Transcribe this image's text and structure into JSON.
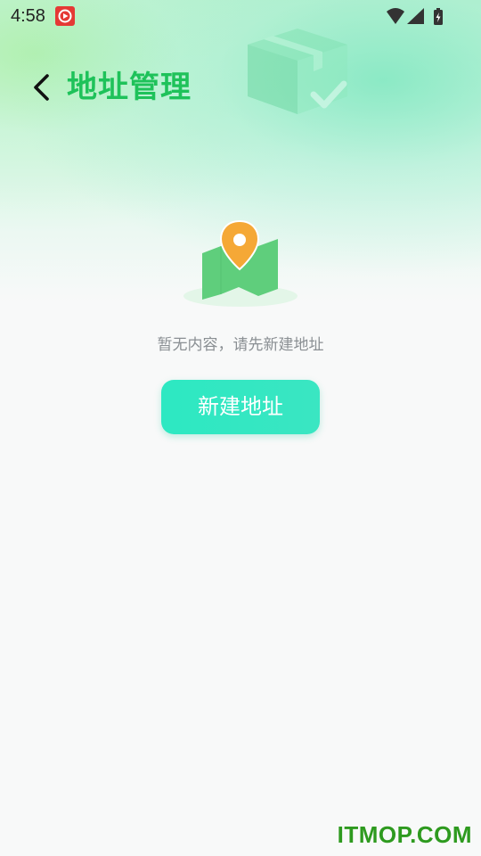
{
  "status_bar": {
    "time": "4:58"
  },
  "header": {
    "title": "地址管理"
  },
  "empty_state": {
    "message": "暂无内容，请先新建地址",
    "button_label": "新建地址"
  },
  "watermark": {
    "text": "ITMOP.COM"
  },
  "icons": {
    "back": "chevron-left-icon",
    "map_pin": "map-pin-icon",
    "wifi": "wifi-icon",
    "signal": "signal-icon",
    "battery": "battery-charging-icon"
  },
  "colors": {
    "title_green": "#1ec25a",
    "button_teal": "#2de8c2",
    "pin_orange": "#f5a836",
    "map_green": "#5fce7c",
    "watermark_green": "#2e9a1f"
  }
}
